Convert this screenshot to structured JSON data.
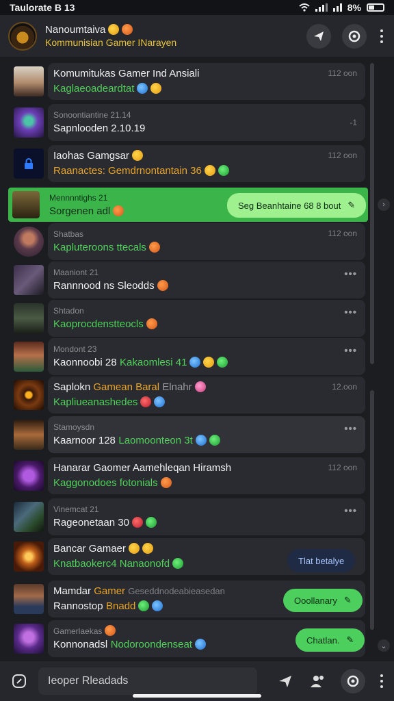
{
  "status_bar": {
    "left": "Taulorate B 13",
    "battery": "8%"
  },
  "header": {
    "title": "Nanoumtaiva",
    "subtitle": "Kommunisian Gamer INarayen",
    "avatar_icon": "gamer-avatar-icon",
    "actions": [
      "send-icon",
      "camera-icon",
      "more-vert-icon"
    ]
  },
  "chats": [
    {
      "name": "Komumitukas Gamer Ind Ansiali",
      "preview": "Kaglaeoadeardtat",
      "time": "112 oon",
      "emojis": [
        "b",
        "y"
      ],
      "avatar": "avatar-man-hat"
    },
    {
      "name": "Sonoontiantine 21.14",
      "preview": "Sapnlooden 2.10.19",
      "time": "-1",
      "emojis": [],
      "avatar": "avatar-robot-purple"
    },
    {
      "name": "Iaohas Gamgsar",
      "preview": "Raanactes: Gemdrnontantain 36",
      "time": "112 oon",
      "emojis": [
        "y",
        "g"
      ],
      "avatar": "avatar-lock-blue"
    },
    {
      "name": "Mennnntighs 21",
      "preview": "Sorgenen adl",
      "time": "",
      "emojis": [
        "o"
      ],
      "avatar": "avatar-soldier"
    },
    {
      "name": "Shatbas",
      "preview": "Kapluteroons ttecals",
      "time": "112 oon",
      "emojis": [
        "o"
      ],
      "avatar": "avatar-woman-round"
    },
    {
      "name": "Maaniont 21",
      "preview": "Rannnood ns Sleodds",
      "time": "•••",
      "emojis": [
        "o"
      ],
      "avatar": "avatar-gunner"
    },
    {
      "name": "Shtadon",
      "preview": "Kaoprocdenstteocls",
      "time": "•••",
      "emojis": [
        "o"
      ],
      "avatar": "avatar-soldier-dark"
    },
    {
      "name": "Mondont 23",
      "preview": "Kaonnoobi 28",
      "preview_extra": "Kakaomlesi 41",
      "time": "•••",
      "emojis": [
        "b",
        "y",
        "g"
      ],
      "avatar": "avatar-man-beard"
    },
    {
      "name": "Saplokn",
      "name_extra": "Gamean Baral",
      "name_tail": "Elnahr",
      "preview": "Kapliueanashedes",
      "time": "12.oon",
      "emojis": [
        "p",
        "r",
        "b"
      ],
      "avatar": "avatar-fire-eye"
    },
    {
      "name": "Stamoysdn",
      "preview": "Kaarnoor 128",
      "preview_extra": "Laomoonteon 3t",
      "time": "•••",
      "emojis": [
        "b",
        "g"
      ],
      "avatar": "avatar-cowboy"
    },
    {
      "name": "Hanarar Gaomer Aamehleqan Hiramsh",
      "preview": "Kaggonodoes fotonials",
      "time": "112 oon",
      "emojis": [
        "o"
      ],
      "avatar": "avatar-purple-beast"
    },
    {
      "name": "Vinemcat 21",
      "preview": "Rageonetaan 30",
      "time": "•••",
      "emojis": [
        "r",
        "g"
      ],
      "avatar": "avatar-battle"
    },
    {
      "name": "Bancar Gamaer",
      "preview": "Knatbaokerc4 Nanaonofd",
      "time": "",
      "emojis": [
        "y",
        "g"
      ],
      "avatar": "avatar-explosion"
    },
    {
      "name": "Mamdar",
      "name_extra": "Gamer",
      "name_tail": "Geseddnodeabieasedan",
      "preview": "Rannostop",
      "preview_extra": "Bnadd",
      "time": "",
      "emojis": [
        "g",
        "b"
      ],
      "avatar": "avatar-woman-warrior"
    },
    {
      "name": "Gamerlaekas",
      "preview": "Konnonadsl",
      "preview_extra": "Nodoroondenseat",
      "time": "",
      "emojis": [
        "b"
      ],
      "avatar": "avatar-purple-hood"
    }
  ],
  "pills": {
    "highlight": "Seg Beanhtaine 68 8 bout",
    "dark": "Tlat betalye",
    "green_1": "Ooollanary",
    "green_2": "Chatlan."
  },
  "bottom": {
    "search_placeholder": "Ieoper Rleadads",
    "icons": [
      "compose-icon",
      "send-icon",
      "people-icon",
      "camera-icon",
      "more-vert-icon"
    ]
  }
}
